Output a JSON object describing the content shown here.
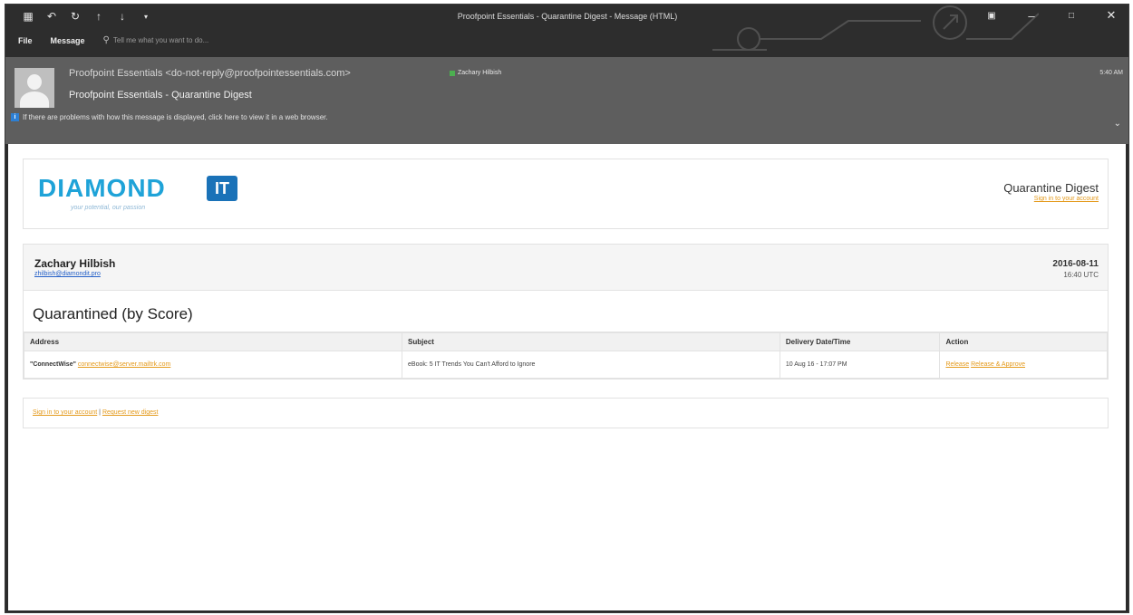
{
  "window": {
    "title": "Proofpoint Essentials - Quarantine Digest - Message (HTML)",
    "icons": [
      "save-icon",
      "undo-icon",
      "redo-icon",
      "up-arrow-icon",
      "down-arrow-icon",
      "customize-icon"
    ]
  },
  "ribbon": {
    "tabs": [
      "File",
      "Message"
    ],
    "tell_me": "Tell me what you want to do..."
  },
  "message": {
    "from": "Proofpoint Essentials <do-not-reply@proofpointessentials.com>",
    "to": "Zachary Hilbish",
    "subject": "Proofpoint Essentials - Quarantine Digest",
    "info": "If there are problems with how this message is displayed, click here to view it in a web browser.",
    "time": "5:40 AM"
  },
  "brand": {
    "logo_text": "DIAMOND",
    "logo_badge": "IT",
    "tagline": "your potential, our passion",
    "digest_title": "Quarantine Digest",
    "signin": "Sign in to your account"
  },
  "user": {
    "name": "Zachary Hilbish",
    "email": "zhilbish@diamondit.pro",
    "date": "2016-08-11",
    "time": "16:40 UTC"
  },
  "quarantine": {
    "title": "Quarantined (by Score)",
    "columns": [
      "Address",
      "Subject",
      "Delivery Date/Time",
      "Action"
    ],
    "rows": [
      {
        "sender_name": "\"ConnectWise\"",
        "sender_email": "connectwise@server.mailtrk.com",
        "subject": "eBook: 5 IT Trends You Can't Afford to Ignore",
        "delivery": "10 Aug 16 - 17:07 PM",
        "action_release": "Release",
        "action_release_approve": "Release & Approve"
      }
    ]
  },
  "footer": {
    "signin": "Sign in to your account",
    "separator": "|",
    "request": "Request new digest"
  },
  "colors": {
    "link_orange": "#e49a1c",
    "brand_blue": "#1fa3d8",
    "frame_dark": "#2d2d2d",
    "header_gray": "#5e5e5e"
  }
}
